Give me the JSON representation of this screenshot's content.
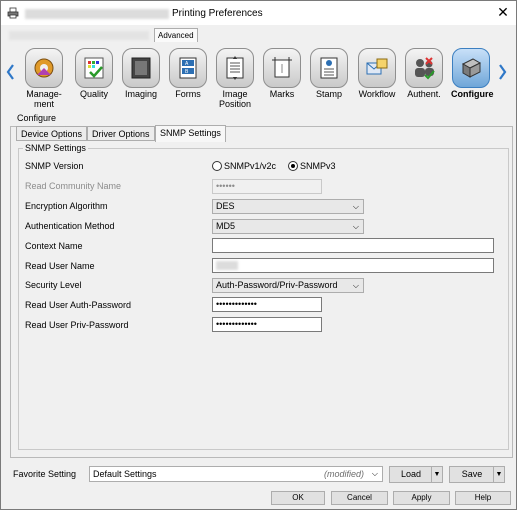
{
  "window": {
    "title": "Printing Preferences",
    "advanced_tab": "Advanced"
  },
  "categories": [
    {
      "label": "Manage-\nment",
      "icon": "management-icon"
    },
    {
      "label": "Quality",
      "icon": "quality-icon"
    },
    {
      "label": "Imaging",
      "icon": "imaging-icon"
    },
    {
      "label": "Forms",
      "icon": "forms-icon"
    },
    {
      "label": "Image\nPosition",
      "icon": "image-position-icon"
    },
    {
      "label": "Marks",
      "icon": "marks-icon"
    },
    {
      "label": "Stamp",
      "icon": "stamp-icon"
    },
    {
      "label": "Workflow",
      "icon": "workflow-icon"
    },
    {
      "label": "Authent.",
      "icon": "authentication-icon"
    },
    {
      "label": "Configure",
      "icon": "configure-icon"
    }
  ],
  "section_label": "Configure",
  "subtabs": [
    "Device Options",
    "Driver Options",
    "SNMP Settings"
  ],
  "snmp": {
    "group_title": "SNMP Settings",
    "version_label": "SNMP Version",
    "v1_label": "SNMPv1/v2c",
    "v3_label": "SNMPv3",
    "community_label": "Read Community Name",
    "community_value": "••••••",
    "encryption_label": "Encryption Algorithm",
    "encryption_value": "DES",
    "auth_method_label": "Authentication Method",
    "auth_method_value": "MD5",
    "context_label": "Context Name",
    "context_value": "",
    "user_label": "Read User Name",
    "security_label": "Security Level",
    "security_value": "Auth-Password/Priv-Password",
    "auth_pw_label": "Read User Auth-Password",
    "auth_pw_value": "•••••••••••••",
    "priv_pw_label": "Read User Priv-Password",
    "priv_pw_value": "•••••••••••••"
  },
  "footer": {
    "favorite_label": "Favorite Setting",
    "favorite_value": "Default Settings",
    "modified": "(modified)",
    "load": "Load",
    "save": "Save",
    "ok": "OK",
    "cancel": "Cancel",
    "apply": "Apply",
    "help": "Help"
  }
}
